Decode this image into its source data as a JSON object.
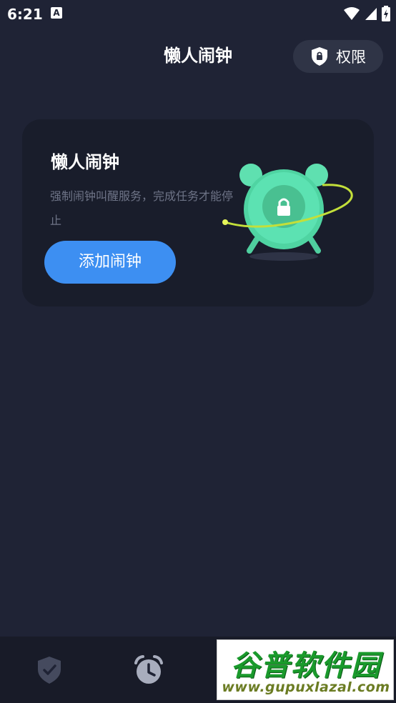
{
  "status_bar": {
    "time": "6:21",
    "notification_icon": "A",
    "icons": [
      "wifi-icon",
      "signal-icon",
      "battery-charging-icon"
    ]
  },
  "header": {
    "title": "懒人闹钟",
    "permission_button_label": "权限",
    "permission_icon": "shield-lock-icon"
  },
  "card": {
    "title": "懒人闹钟",
    "description": "强制闹钟叫醒服务，完成任务才能停止",
    "add_button_label": "添加闹钟",
    "illustration": "alarm-clock-lock-icon",
    "accent_color": "#3d8ff2",
    "illustration_color": "#5fe0b0"
  },
  "bottom_nav": {
    "items": [
      {
        "icon": "shield-check-icon",
        "active": false
      },
      {
        "icon": "alarm-clock-icon",
        "active": true
      }
    ]
  },
  "watermark": {
    "brand": "谷普软件园",
    "url": "www.gupuxlazal.com"
  }
}
